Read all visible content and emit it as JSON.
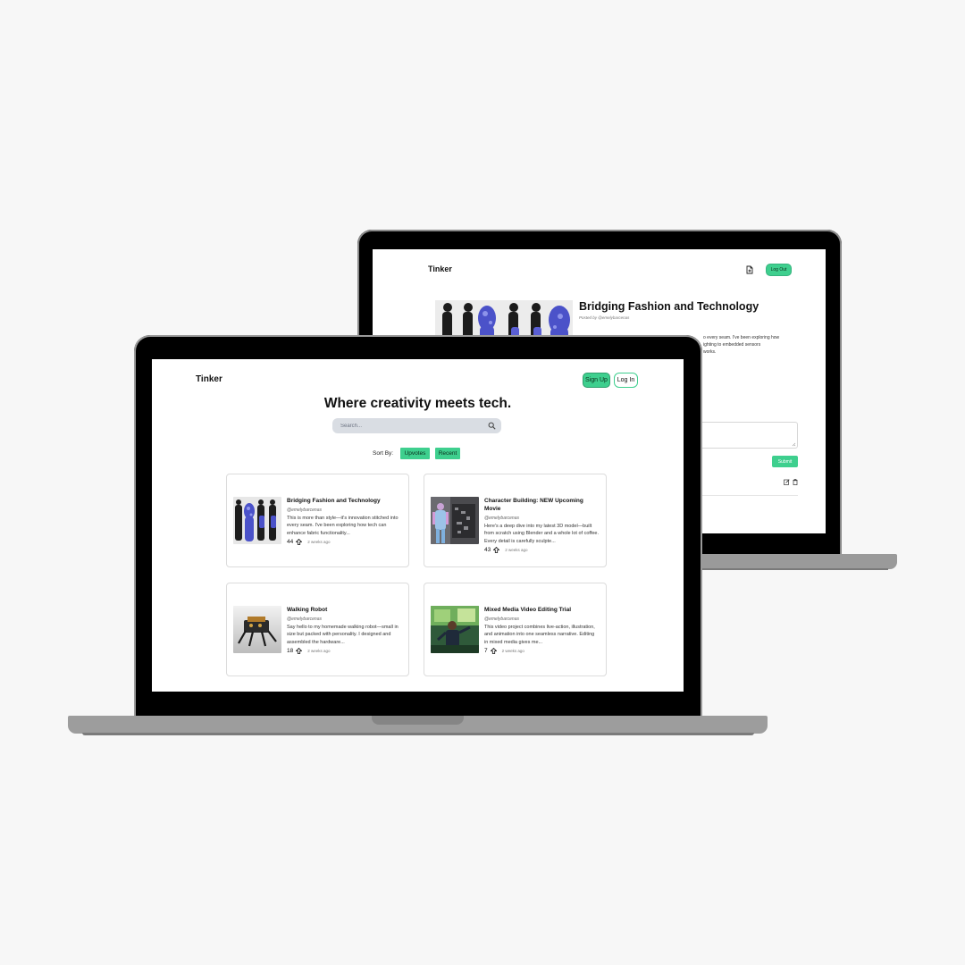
{
  "back_screen": {
    "brand": "Tinker",
    "logout_label": "Log Out",
    "post": {
      "title": "Bridging Fashion and Technology",
      "author_line": "Posted by @emelybarcenas",
      "body_lines": [
        "o every seam. I've been exploring how",
        "ighting to embedded sensors",
        "works."
      ]
    },
    "submit_label": "Submit"
  },
  "front_screen": {
    "brand": "Tinker",
    "signup_label": "Sign Up",
    "login_label": "Log In",
    "headline": "Where creativity meets tech.",
    "search": {
      "placeholder": "Search..."
    },
    "sort": {
      "label": "Sort By:",
      "upvotes_label": "Upvotes",
      "recent_label": "Recent"
    },
    "posts": [
      {
        "title": "Bridging Fashion and Technology",
        "author": "@emelybarcenas",
        "desc": "This is more than style—it's innovation stitched into every seam. I've been exploring how tech can enhance fabric functionality...",
        "upvotes": "44",
        "time": "2 weeks ago"
      },
      {
        "title": "Character Building: NEW Upcoming Movie",
        "author": "@emelybarcenas",
        "desc": "Here's a deep dive into my latest 3D model—built from scratch using Blender and a whole lot of coffee. Every detail is carefully sculpte...",
        "upvotes": "43",
        "time": "2 weeks ago"
      },
      {
        "title": "Walking Robot",
        "author": "@emelybarcenas",
        "desc": "Say hello to my homemade walking robot—small in size but packed with personality. I designed and assembled the hardware...",
        "upvotes": "18",
        "time": "2 weeks ago"
      },
      {
        "title": "Mixed Media Video Editing Trial",
        "author": "@emelybarcenas",
        "desc": "This video project combines live-action, illustration, and animation into one seamless narrative. Editing in mixed media gives me...",
        "upvotes": "7",
        "time": "2 weeks ago"
      }
    ]
  },
  "colors": {
    "accent": "#3ecf8e",
    "background": "#f7f7f7",
    "bezel": "#000000",
    "chassis": "#9d9d9d"
  },
  "icons": [
    "new-post-icon",
    "search-icon",
    "upvote-icon",
    "edit-icon",
    "trash-icon"
  ]
}
